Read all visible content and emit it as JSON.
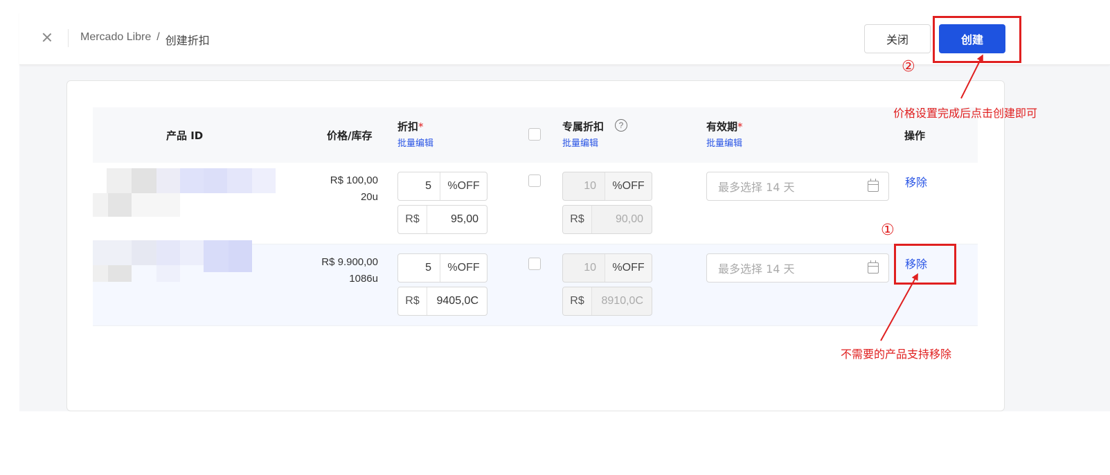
{
  "header": {
    "breadcrumb_root": "Mercado Libre",
    "breadcrumb_sep": "/",
    "breadcrumb_current": "创建折扣",
    "close_button": "关闭",
    "create_button": "创建"
  },
  "table": {
    "columns": {
      "product_id": "产品 ID",
      "price_stock": "价格/库存",
      "discount": "折扣",
      "exclusive_discount": "专属折扣",
      "validity": "有效期",
      "actions": "操作"
    },
    "required_mark": "*",
    "bulk_edit": "批量编辑",
    "help_glyph": "?",
    "rows": [
      {
        "price": "R$ 100,00",
        "stock": "20u",
        "discount_pct": "5",
        "pct_suffix": "%OFF",
        "currency": "R$",
        "discount_price": "95,00",
        "exclusive_pct": "10",
        "exclusive_price": "90,00",
        "date_placeholder": "最多选择 14 天",
        "remove": "移除"
      },
      {
        "price": "R$ 9.900,00",
        "stock": "1086u",
        "discount_pct": "5",
        "pct_suffix": "%OFF",
        "currency": "R$",
        "discount_price": "9405,0C",
        "exclusive_pct": "10",
        "exclusive_price": "8910,0C",
        "date_placeholder": "最多选择 14 天",
        "remove": "移除"
      }
    ]
  },
  "annotations": {
    "step1_marker": "①",
    "step2_marker": "②",
    "create_note": "价格设置完成后点击创建即可",
    "remove_note": "不需要的产品支持移除",
    "color": "#e02020"
  },
  "colors": {
    "primary": "#1e53e0",
    "link": "#2a55e5",
    "annotation": "#e02020"
  }
}
